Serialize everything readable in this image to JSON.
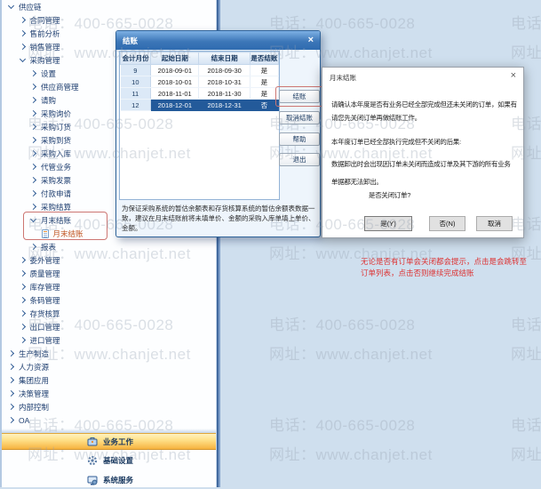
{
  "watermark": {
    "phone": "电话：400-665-0028",
    "url": "网址：www.chanjet.net"
  },
  "sidebar": {
    "tree": [
      {
        "label": "供应链",
        "level": 0,
        "state": "expanded"
      },
      {
        "label": "合同管理",
        "level": 1,
        "state": "collapsed"
      },
      {
        "label": "售前分析",
        "level": 1,
        "state": "collapsed"
      },
      {
        "label": "销售管理",
        "level": 1,
        "state": "collapsed"
      },
      {
        "label": "采购管理",
        "level": 1,
        "state": "expanded"
      },
      {
        "label": "设置",
        "level": 2,
        "state": "collapsed"
      },
      {
        "label": "供应商管理",
        "level": 2,
        "state": "collapsed"
      },
      {
        "label": "请购",
        "level": 2,
        "state": "collapsed"
      },
      {
        "label": "采购询价",
        "level": 2,
        "state": "collapsed"
      },
      {
        "label": "采购订货",
        "level": 2,
        "state": "collapsed"
      },
      {
        "label": "采购到货",
        "level": 2,
        "state": "collapsed"
      },
      {
        "label": "采购入库",
        "level": 2,
        "state": "collapsed"
      },
      {
        "label": "代管业务",
        "level": 2,
        "state": "collapsed"
      },
      {
        "label": "采购发票",
        "level": 2,
        "state": "collapsed"
      },
      {
        "label": "付款申请",
        "level": 2,
        "state": "collapsed"
      },
      {
        "label": "采购结算",
        "level": 2,
        "state": "collapsed"
      },
      {
        "label": "月末结账",
        "level": 2,
        "state": "expanded",
        "highlighted": true
      },
      {
        "label": "月末结账",
        "level": 3,
        "state": "leaf",
        "selected": true
      },
      {
        "label": "报表",
        "level": 2,
        "state": "collapsed"
      },
      {
        "label": "委外管理",
        "level": 1,
        "state": "collapsed"
      },
      {
        "label": "质量管理",
        "level": 1,
        "state": "collapsed"
      },
      {
        "label": "库存管理",
        "level": 1,
        "state": "collapsed"
      },
      {
        "label": "条码管理",
        "level": 1,
        "state": "collapsed"
      },
      {
        "label": "存货核算",
        "level": 1,
        "state": "collapsed"
      },
      {
        "label": "出口管理",
        "level": 1,
        "state": "collapsed"
      },
      {
        "label": "进口管理",
        "level": 1,
        "state": "collapsed"
      },
      {
        "label": "生产制造",
        "level": 0,
        "state": "collapsed"
      },
      {
        "label": "人力资源",
        "level": 0,
        "state": "collapsed"
      },
      {
        "label": "集团应用",
        "level": 0,
        "state": "collapsed"
      },
      {
        "label": "决策管理",
        "level": 0,
        "state": "collapsed"
      },
      {
        "label": "内部控制",
        "level": 0,
        "state": "collapsed"
      },
      {
        "label": "OA",
        "level": 0,
        "state": "collapsed"
      }
    ],
    "bottom_nav": [
      {
        "label": "业务工作",
        "icon": "briefcase-icon",
        "active": true
      },
      {
        "label": "基础设置",
        "icon": "gear-icon",
        "active": false
      },
      {
        "label": "系统服务",
        "icon": "services-icon",
        "active": false
      }
    ]
  },
  "settle_dialog": {
    "title": "结账",
    "close_label": "×",
    "table": {
      "headers": [
        "会计月份",
        "起始日期",
        "结束日期",
        "是否结账"
      ],
      "rows": [
        {
          "month": "9",
          "start": "2018-09-01",
          "end": "2018-09-30",
          "closed": "是",
          "selected": false
        },
        {
          "month": "10",
          "start": "2018-10-01",
          "end": "2018-10-31",
          "closed": "是",
          "selected": false
        },
        {
          "month": "11",
          "start": "2018-11-01",
          "end": "2018-11-30",
          "closed": "是",
          "selected": false
        },
        {
          "month": "12",
          "start": "2018-12-01",
          "end": "2018-12-31",
          "closed": "否",
          "selected": true
        }
      ]
    },
    "buttons": [
      {
        "label": "结账",
        "highlighted": true
      },
      {
        "label": "取消结账",
        "highlighted": false
      },
      {
        "label": "帮助",
        "highlighted": false
      },
      {
        "label": "退出",
        "highlighted": false
      }
    ],
    "note": "为保证采购系统的暂估余额表和存货核算系统的暂估余额表数据一致，建议在月末结账前将未填单价、金额的采购入库单填上单价、金额。"
  },
  "confirm_dialog": {
    "title": "月末结账",
    "close_label": "×",
    "lines": [
      "请确认本年度是否有业务已经全部完成但还未关闭的订单，如果有",
      "请您先关闭订单再做结账工作。",
      "本年度订单已经全部执行完成但不关闭的后果:",
      "数据卸出时会出现因订单未关闭而造成订单及其下游的所有业务",
      "单据都无法卸出。",
      "是否关闭订单?"
    ],
    "buttons": [
      {
        "label": "是(Y)"
      },
      {
        "label": "否(N)"
      },
      {
        "label": "取消"
      }
    ]
  },
  "annotation": {
    "lines": [
      "无论是否有订单会关闭都会提示，点击是会跳转至",
      "订单列表，点击否则继续完成结账"
    ],
    "color": "#dd3333"
  },
  "colors": {
    "background": "#cfdfee",
    "titlebar_blue": "#3671b5",
    "selected_row_blue": "#235a9a",
    "highlight_box_red": "#cd7672",
    "annotation_red": "#dd3333",
    "active_nav_yellow": "#ffe18a",
    "tree_text": "#1c3c6e",
    "selected_tree_item_orange": "#c0531f"
  }
}
